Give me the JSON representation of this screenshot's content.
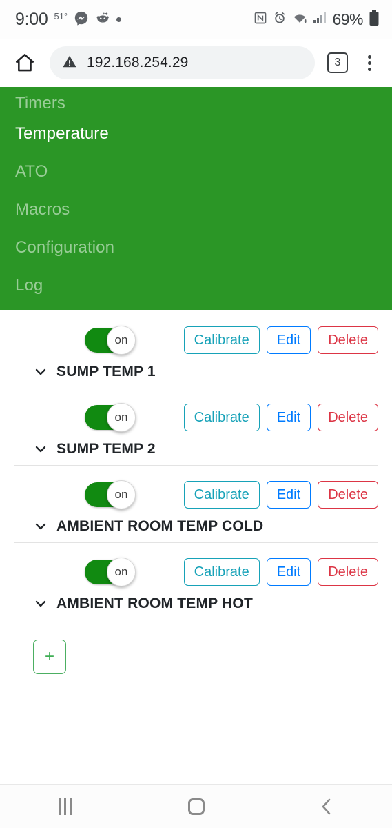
{
  "status_bar": {
    "time": "9:00",
    "temperature": "51°",
    "notification_icons": [
      "messenger-icon",
      "reddit-icon",
      "dot-icon"
    ],
    "system_icons": [
      "nfc-icon",
      "alarm-icon",
      "wifi-icon",
      "cellular-signal-icon"
    ],
    "battery_percent": "69%"
  },
  "browser": {
    "home_icon": "home-icon",
    "security_icon": "not-secure-warning-icon",
    "url": "192.168.254.29",
    "tab_count": "3",
    "menu_icon": "overflow-menu-icon"
  },
  "nav": {
    "items": [
      {
        "label": "Timers",
        "active": false
      },
      {
        "label": "Temperature",
        "active": true
      },
      {
        "label": "ATO",
        "active": false
      },
      {
        "label": "Macros",
        "active": false
      },
      {
        "label": "Configuration",
        "active": false
      },
      {
        "label": "Log",
        "active": false
      }
    ]
  },
  "probes": {
    "toggle_label": "on",
    "buttons": {
      "calibrate": "Calibrate",
      "edit": "Edit",
      "delete": "Delete"
    },
    "items": [
      {
        "name": "SUMP TEMP 1",
        "enabled": "on"
      },
      {
        "name": "SUMP TEMP 2",
        "enabled": "on"
      },
      {
        "name": "AMBIENT ROOM TEMP COLD",
        "enabled": "on"
      },
      {
        "name": "AMBIENT ROOM TEMP HOT",
        "enabled": "on"
      }
    ],
    "add_label": "+"
  },
  "system_nav": {
    "recents_icon": "recents-icon",
    "home_icon": "home-square-icon",
    "back_icon": "back-chevron-icon"
  },
  "colors": {
    "nav_green": "#2b9626",
    "toggle_green": "#118a11",
    "calibrate": "#17a2b8",
    "edit": "#007bff",
    "delete": "#dc3545",
    "add": "#4caf62"
  }
}
